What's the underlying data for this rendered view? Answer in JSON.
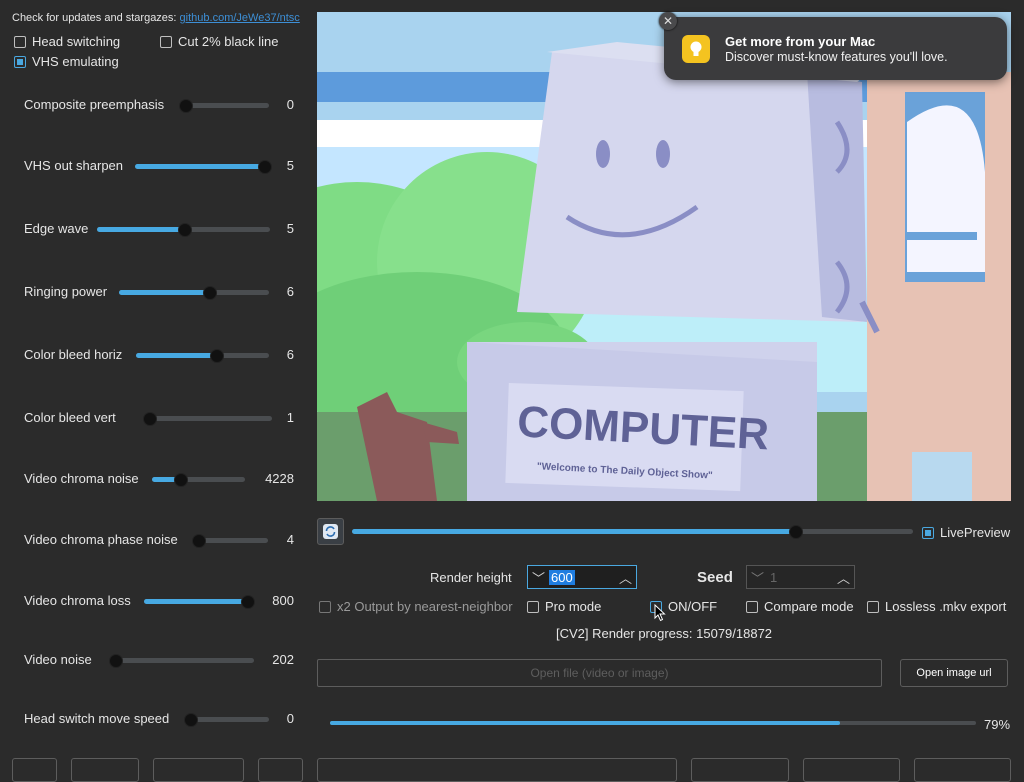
{
  "header": {
    "updates_text": "Check for updates and stargazes:",
    "updates_link": "github.com/JeWe37/ntsc"
  },
  "top_checkboxes": [
    {
      "label": "Head switching",
      "checked": false
    },
    {
      "label": "Cut 2% black line",
      "checked": false
    },
    {
      "label": "VHS emulating",
      "checked": true
    }
  ],
  "sliders": [
    {
      "label": "Composite preemphasis",
      "value": "0",
      "fraction": 0.0
    },
    {
      "label": "VHS out sharpen",
      "value": "5",
      "fraction": 1.0
    },
    {
      "label": "Edge wave",
      "value": "5",
      "fraction": 0.5
    },
    {
      "label": "Ringing power",
      "value": "6",
      "fraction": 0.6
    },
    {
      "label": "Color bleed horiz",
      "value": "6",
      "fraction": 0.6
    },
    {
      "label": "Color bleed vert",
      "value": "1",
      "fraction": 0.0
    },
    {
      "label": "Video chroma noise",
      "value": "4228",
      "fraction": 0.3
    },
    {
      "label": "Video chroma phase noise",
      "value": "4",
      "fraction": 0.06
    },
    {
      "label": "Video chroma loss",
      "value": "800",
      "fraction": 1.0
    },
    {
      "label": "Video noise",
      "value": "202",
      "fraction": 0.02
    },
    {
      "label": "Head switch move speed",
      "value": "0",
      "fraction": 0.0
    }
  ],
  "preview": {
    "sign_text": "COMPUTER",
    "sign_subtext": "\"Welcome to The Daily Object Show\""
  },
  "notification": {
    "title": "Get more from your Mac",
    "body": "Discover must-know features you'll love."
  },
  "timeline": {
    "fraction": 0.79
  },
  "live_preview": {
    "label": "LivePreview",
    "checked": true
  },
  "render_height": {
    "label": "Render height",
    "value": "600"
  },
  "seed": {
    "label": "Seed",
    "value": "1"
  },
  "options": [
    {
      "label": "x2 Output by nearest-neighbor",
      "checked": false
    },
    {
      "label": "Pro mode",
      "checked": false
    },
    {
      "label": "ON/OFF",
      "checked": false
    },
    {
      "label": "Compare mode",
      "checked": false
    },
    {
      "label": "Lossless .mkv export",
      "checked": false
    }
  ],
  "render_progress": "[CV2] Render progress: 15079/18872",
  "open_file": {
    "placeholder": "Open file (video or image)"
  },
  "open_image_url": "Open image url",
  "progress": {
    "fraction": 0.79,
    "label": "79%"
  },
  "colors": {
    "accent": "#47a9e2",
    "background": "#2b2b2b"
  }
}
